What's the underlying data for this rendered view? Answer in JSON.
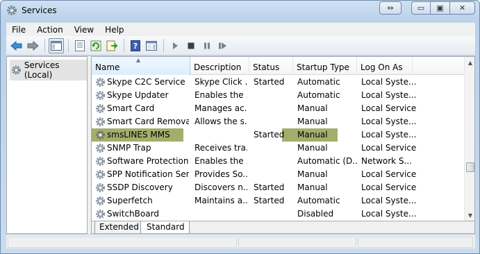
{
  "window": {
    "title": "Services",
    "icon": "gear-icon"
  },
  "caption": {
    "restore_glyph": "⇔",
    "minimize_glyph": "▭",
    "maximize_glyph": "▣",
    "close_glyph": "✕"
  },
  "menu": [
    "File",
    "Action",
    "View",
    "Help"
  ],
  "toolbar": {
    "buttons": [
      "back-arrow-icon",
      "forward-arrow-icon",
      "show-hide-console-tree-icon",
      "properties-icon",
      "refresh-icon",
      "export-list-icon",
      "help-icon",
      "show-action-pane-icon",
      "start-service-icon",
      "stop-service-icon",
      "pause-service-icon",
      "restart-service-icon"
    ]
  },
  "tree": {
    "root": "Services (Local)"
  },
  "columns": [
    "Name",
    "Description",
    "Status",
    "Startup Type",
    "Log On As"
  ],
  "highlight_color": "#a4ae6c",
  "rows": [
    {
      "name": "Skype C2C Service",
      "description": "Skype Click ...",
      "status": "Started",
      "startup": "Automatic",
      "logon": "Local Syste..."
    },
    {
      "name": "Skype Updater",
      "description": "Enables the ...",
      "status": "",
      "startup": "Automatic",
      "logon": "Local Syste..."
    },
    {
      "name": "Smart Card",
      "description": "Manages ac...",
      "status": "",
      "startup": "Manual",
      "logon": "Local Service"
    },
    {
      "name": "Smart Card Removal...",
      "description": "Allows the s...",
      "status": "",
      "startup": "Manual",
      "logon": "Local Syste..."
    },
    {
      "name": "smsLINES MMS",
      "description": "",
      "status": "Started",
      "startup": "Manual",
      "logon": "Local Syste..."
    },
    {
      "name": "SNMP Trap",
      "description": "Receives tra...",
      "status": "",
      "startup": "Manual",
      "logon": "Local Service"
    },
    {
      "name": "Software Protection",
      "description": "Enables the ...",
      "status": "",
      "startup": "Automatic (D...",
      "logon": "Network S..."
    },
    {
      "name": "SPP Notification Ser...",
      "description": "Provides So...",
      "status": "",
      "startup": "Manual",
      "logon": "Local Service"
    },
    {
      "name": "SSDP Discovery",
      "description": "Discovers n...",
      "status": "Started",
      "startup": "Manual",
      "logon": "Local Service"
    },
    {
      "name": "Superfetch",
      "description": "Maintains a...",
      "status": "Started",
      "startup": "Automatic",
      "logon": "Local Syste..."
    },
    {
      "name": "SwitchBoard",
      "description": "",
      "status": "",
      "startup": "Disabled",
      "logon": "Local Syste..."
    }
  ],
  "tabs": [
    "Extended",
    "Standard"
  ]
}
